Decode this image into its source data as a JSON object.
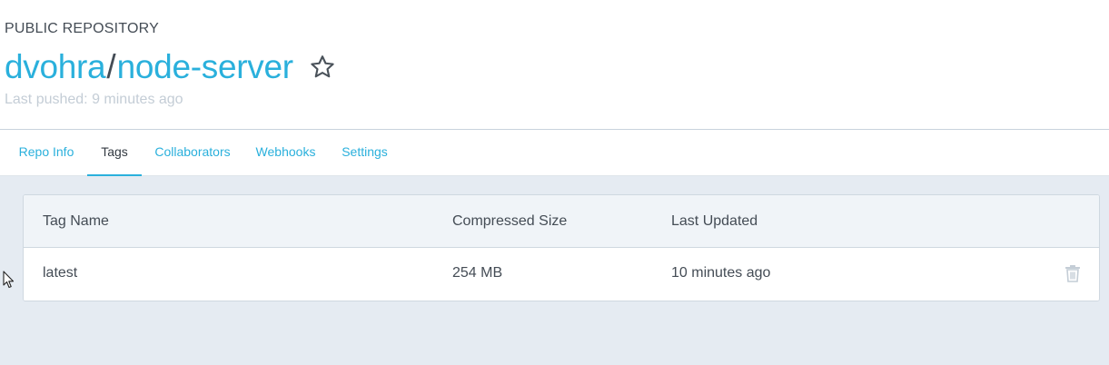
{
  "repo": {
    "visibility": "PUBLIC REPOSITORY",
    "owner": "dvohra",
    "separator": "/",
    "name": "node-server",
    "last_pushed": "Last pushed: 9 minutes ago"
  },
  "icons": {
    "star": "star-outline-icon",
    "trash": "trash-icon",
    "cursor": "mouse-pointer-icon"
  },
  "tabs": [
    {
      "label": "Repo Info",
      "active": false
    },
    {
      "label": "Tags",
      "active": true
    },
    {
      "label": "Collaborators",
      "active": false
    },
    {
      "label": "Webhooks",
      "active": false
    },
    {
      "label": "Settings",
      "active": false
    }
  ],
  "tags_table": {
    "headers": [
      "Tag Name",
      "Compressed Size",
      "Last Updated"
    ],
    "rows": [
      {
        "tag_name": "latest",
        "compressed_size": "254 MB",
        "last_updated": "10 minutes ago"
      }
    ]
  },
  "colors": {
    "accent": "#2ab0dc",
    "text": "#444c55",
    "muted": "#c4cdd6",
    "background": "#e5ebf2"
  }
}
